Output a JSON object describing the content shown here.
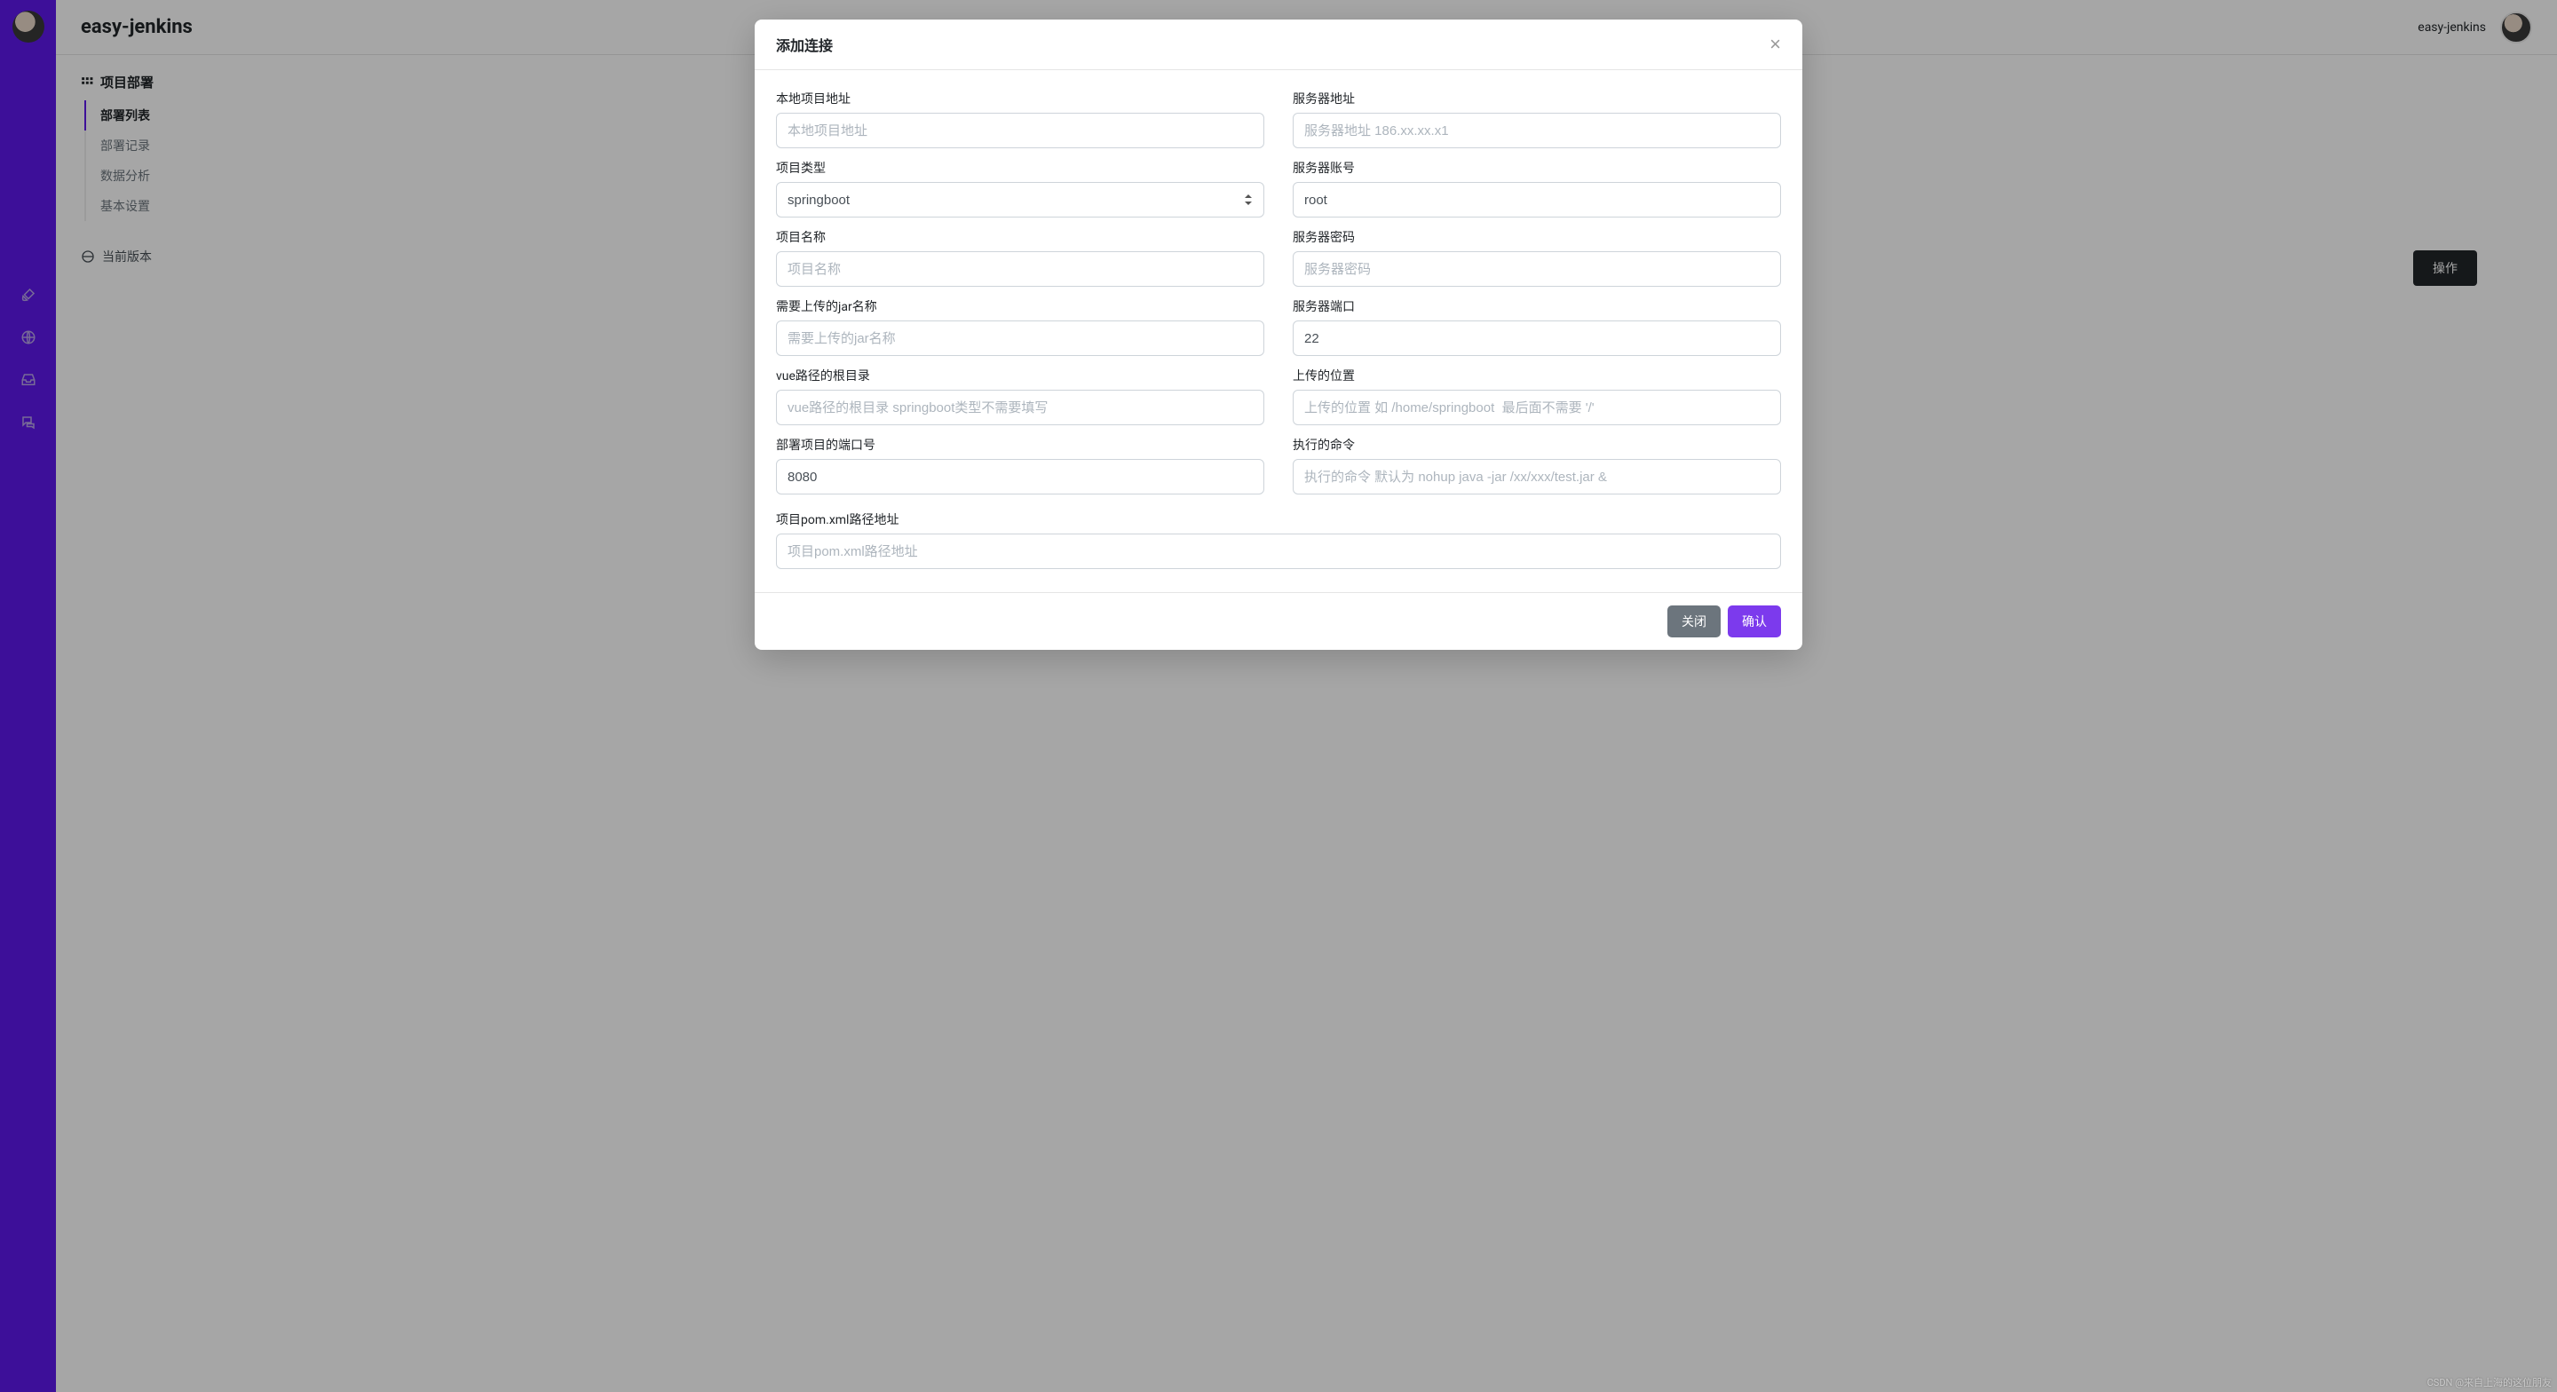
{
  "brand_title": "easy-jenkins",
  "top_right_label": "easy-jenkins",
  "sidebar": {
    "heading": "项目部署",
    "items": [
      {
        "label": "部署列表",
        "active": true
      },
      {
        "label": "部署记录",
        "active": false
      },
      {
        "label": "数据分析",
        "active": false
      },
      {
        "label": "基本设置",
        "active": false
      }
    ],
    "version_label": "当前版本"
  },
  "table_action_header": "操作",
  "modal": {
    "title": "添加连接",
    "close_button": "×",
    "left_fields": [
      {
        "label": "本地项目地址",
        "placeholder": "本地项目地址",
        "value": ""
      },
      {
        "label": "项目类型",
        "type": "select",
        "selected": "springboot"
      },
      {
        "label": "项目名称",
        "placeholder": "项目名称",
        "value": ""
      },
      {
        "label": "需要上传的jar名称",
        "placeholder": "需要上传的jar名称",
        "value": ""
      },
      {
        "label": "vue路径的根目录",
        "placeholder": "vue路径的根目录 springboot类型不需要填写",
        "value": ""
      },
      {
        "label": "部署项目的端口号",
        "placeholder": "",
        "value": "8080"
      }
    ],
    "right_fields": [
      {
        "label": "服务器地址",
        "placeholder": "服务器地址 186.xx.xx.x1",
        "value": ""
      },
      {
        "label": "服务器账号",
        "placeholder": "",
        "value": "root"
      },
      {
        "label": "服务器密码",
        "placeholder": "服务器密码",
        "value": ""
      },
      {
        "label": "服务器端口",
        "placeholder": "",
        "value": "22"
      },
      {
        "label": "上传的位置",
        "placeholder": "上传的位置 如 /home/springboot  最后面不需要 '/'",
        "value": ""
      },
      {
        "label": "执行的命令",
        "placeholder": "执行的命令 默认为 nohup java -jar /xx/xxx/test.jar &",
        "value": ""
      }
    ],
    "full_field": {
      "label": "项目pom.xml路径地址",
      "placeholder": "项目pom.xml路径地址",
      "value": ""
    },
    "footer": {
      "close_label": "关闭",
      "confirm_label": "确认"
    }
  },
  "watermark": "CSDN @来自上海的这位朋友"
}
